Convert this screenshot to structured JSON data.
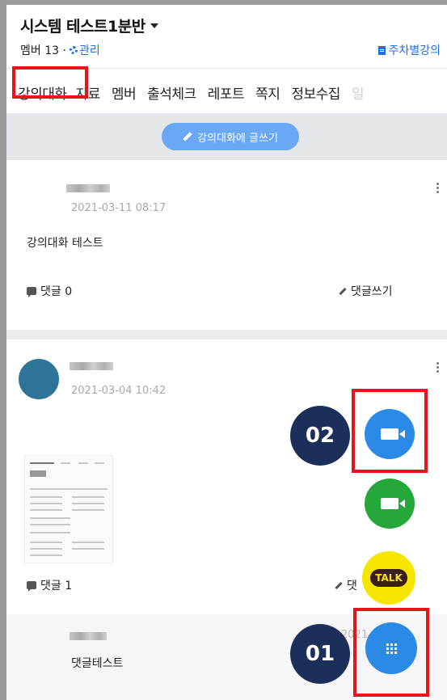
{
  "header": {
    "title": "시스템 테스트1분반",
    "member_label": "멤버 13 ·",
    "manage_label": "관리",
    "weekly_label": "주차별강의"
  },
  "tabs": [
    {
      "label": "강의대화"
    },
    {
      "label": "자료"
    },
    {
      "label": "멤버"
    },
    {
      "label": "출석체크"
    },
    {
      "label": "레포트"
    },
    {
      "label": "쪽지"
    },
    {
      "label": "정보수집"
    },
    {
      "label": "일"
    }
  ],
  "write_button": "강의대화에 글쓰기",
  "posts": [
    {
      "date": "2021-03-11 08:17",
      "content": "강의대화 테스트",
      "comments": "댓글 0",
      "write_comment": "댓글쓰기"
    },
    {
      "date": "2021-03-04 10:42",
      "comments": "댓글 1",
      "write_comment": "댓",
      "reply_text": "댓글테스트",
      "reply_date": "2021-03-04"
    }
  ],
  "fabs": {
    "talk_label": "TALK",
    "badge_02": "02",
    "badge_01": "01"
  },
  "colors": {
    "accent": "#1f6fe0",
    "highlight": "#e8141c",
    "fab_video_blue": "#2a8ae6",
    "fab_video_green": "#25a83a",
    "fab_kakao": "#f7e600",
    "badge": "#1c2f5a"
  }
}
